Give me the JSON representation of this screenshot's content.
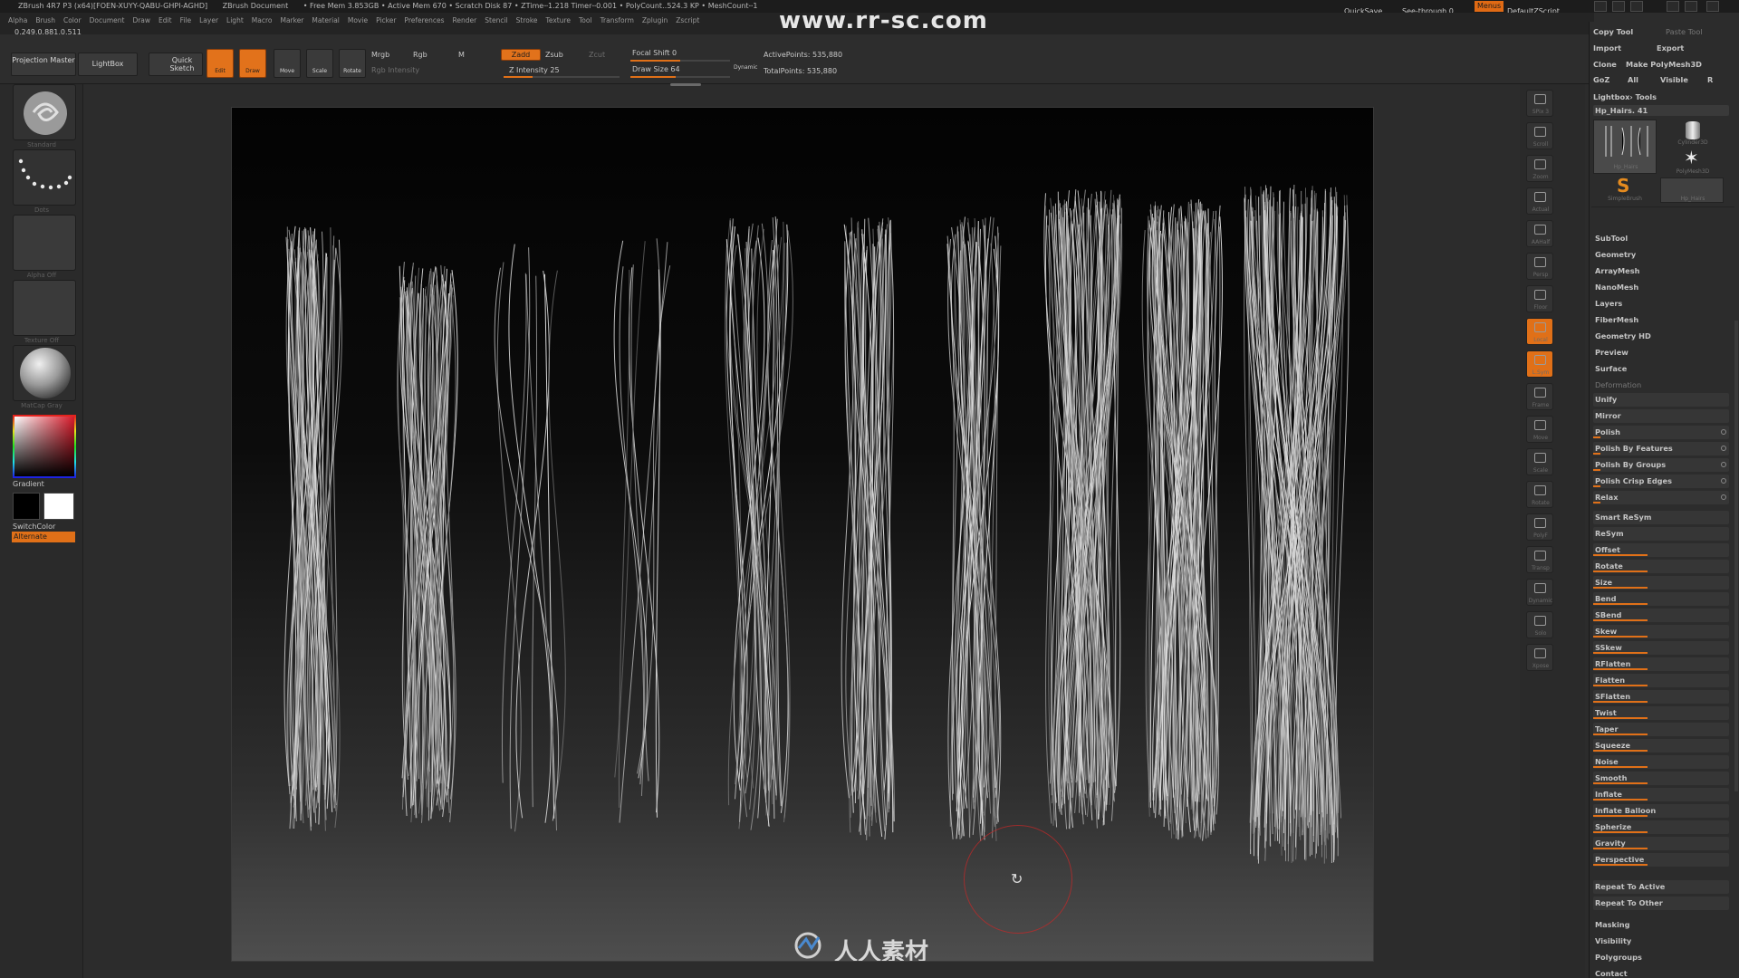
{
  "titlebar": {
    "app": "ZBrush 4R7 P3 (x64)[FOEN-XUYY-QABU-GHPI-AGHD]",
    "doc": "ZBrush Document",
    "stats": "• Free Mem 3.853GB • Active Mem 670 • Scratch Disk 87 • ZTime┄1.218 Timer┄0.001 • PolyCount‥524.3 KP • MeshCount┄1",
    "coords": "0.249,0.881,0.511",
    "quicksave": "QuickSave",
    "seethrough": "See-through 0",
    "menus_btn": "Menus",
    "script": "DefaultZScript"
  },
  "menubar": [
    "Alpha",
    "Brush",
    "Color",
    "Document",
    "Draw",
    "Edit",
    "File",
    "Layer",
    "Light",
    "Macro",
    "Marker",
    "Material",
    "Movie",
    "Picker",
    "Preferences",
    "Render",
    "Stencil",
    "Stroke",
    "Texture",
    "Tool",
    "Transform",
    "Zplugin",
    "Zscript"
  ],
  "toolbar": {
    "projection_master": "Projection Master",
    "lightbox": "LightBox",
    "quick_sketch": "Quick Sketch",
    "edit": "Edit",
    "draw": "Draw",
    "move": "Move",
    "scale": "Scale",
    "rotate": "Rotate",
    "mrgb": "Mrgb",
    "rgb": "Rgb",
    "m": "M",
    "rgb_intensity": "Rgb Intensity",
    "zadd": "Zadd",
    "zsub": "Zsub",
    "zcut": "Zcut",
    "z_intensity": "Z Intensity 25",
    "focal_shift": "Focal Shift 0",
    "draw_size": "Draw Size 64",
    "dynamic": "Dynamic",
    "active_points": "ActivePoints: 535,880",
    "total_points": "TotalPoints: 535,880",
    "z_intensity_level": 0.25,
    "focal_shift_level": 0.5,
    "draw_size_level": 0.45
  },
  "watermark": "www.rr-sc.com",
  "leftshelf": {
    "brush": "Standard",
    "stroke": "Dots",
    "alpha": "Alpha Off",
    "texture": "Texture Off",
    "material": "MatCap Gray",
    "gradient": "Gradient",
    "switchcolor": "SwitchColor",
    "alternate": "Alternate"
  },
  "rightshelf": [
    {
      "label": "SPix 3",
      "icon": "spix-icon"
    },
    {
      "label": "Scroll",
      "icon": "scroll-icon"
    },
    {
      "label": "Zoom",
      "icon": "zoom-icon"
    },
    {
      "label": "Actual",
      "icon": "actual-icon"
    },
    {
      "label": "AAHalf",
      "icon": "aahalf-icon"
    },
    {
      "label": "Persp",
      "icon": "persp-icon"
    },
    {
      "label": "Floor",
      "icon": "floor-icon"
    },
    {
      "label": "Local",
      "icon": "local-icon"
    },
    {
      "label": "L.Sym",
      "icon": "lsym-icon"
    },
    {
      "label": "Frame",
      "icon": "frame-icon"
    },
    {
      "label": "Move",
      "icon": "move-icon"
    },
    {
      "label": "Scale",
      "icon": "scale-icon"
    },
    {
      "label": "Rotate",
      "icon": "rotate-icon"
    },
    {
      "label": "PolyF",
      "icon": "polyf-icon"
    },
    {
      "label": "Transp",
      "icon": "transp-icon"
    },
    {
      "label": "Dynamic",
      "icon": "dynamic-icon"
    },
    {
      "label": "Solo",
      "icon": "solo-icon"
    },
    {
      "label": "Xpose",
      "icon": "xpose-icon"
    }
  ],
  "palette": {
    "copy_tool": "Copy Tool",
    "paste_tool": "Paste Tool",
    "import": "Import",
    "export": "Export",
    "clone": "Clone",
    "make_polymesh": "Make PolyMesh3D",
    "goz": "GoZ",
    "all": "All",
    "visible": "Visible",
    "r": "R",
    "lightbox_tools": "Lightbox› Tools",
    "current_tool": "Hp_Hairs. 41",
    "tool_thumbs": [
      "Hp_Hairs",
      "Cylinder3D",
      "PolyMesh3D",
      "SimpleBrush",
      "Hp_Hairs"
    ],
    "sections": [
      "SubTool",
      "Geometry",
      "ArrayMesh",
      "NanoMesh",
      "Layers",
      "FiberMesh",
      "Geometry HD",
      "Preview",
      "Surface",
      "Deformation"
    ],
    "unify": "Unify",
    "mirror": "Mirror",
    "polish": "Polish",
    "polish_features": "Polish By Features",
    "polish_groups": "Polish By Groups",
    "polish_crisp": "Polish Crisp Edges",
    "relax": "Relax",
    "smart_resym": "Smart ReSym",
    "resym": "ReSym",
    "deform_sliders": [
      "Offset",
      "Rotate",
      "Size",
      "Bend",
      "SBend",
      "Skew",
      "SSkew",
      "RFlatten",
      "Flatten",
      "SFlatten",
      "Twist",
      "Taper",
      "Squeeze",
      "Noise",
      "Smooth",
      "Inflate",
      "Inflate Balloon",
      "Spherize",
      "Gravity",
      "Perspective"
    ],
    "repeat_to_active": "Repeat To Active",
    "repeat_to_other": "Repeat To Other",
    "bottom_sections": [
      "Masking",
      "Visibility",
      "Polygroups",
      "Contact"
    ]
  },
  "logo_text": "人人素材"
}
